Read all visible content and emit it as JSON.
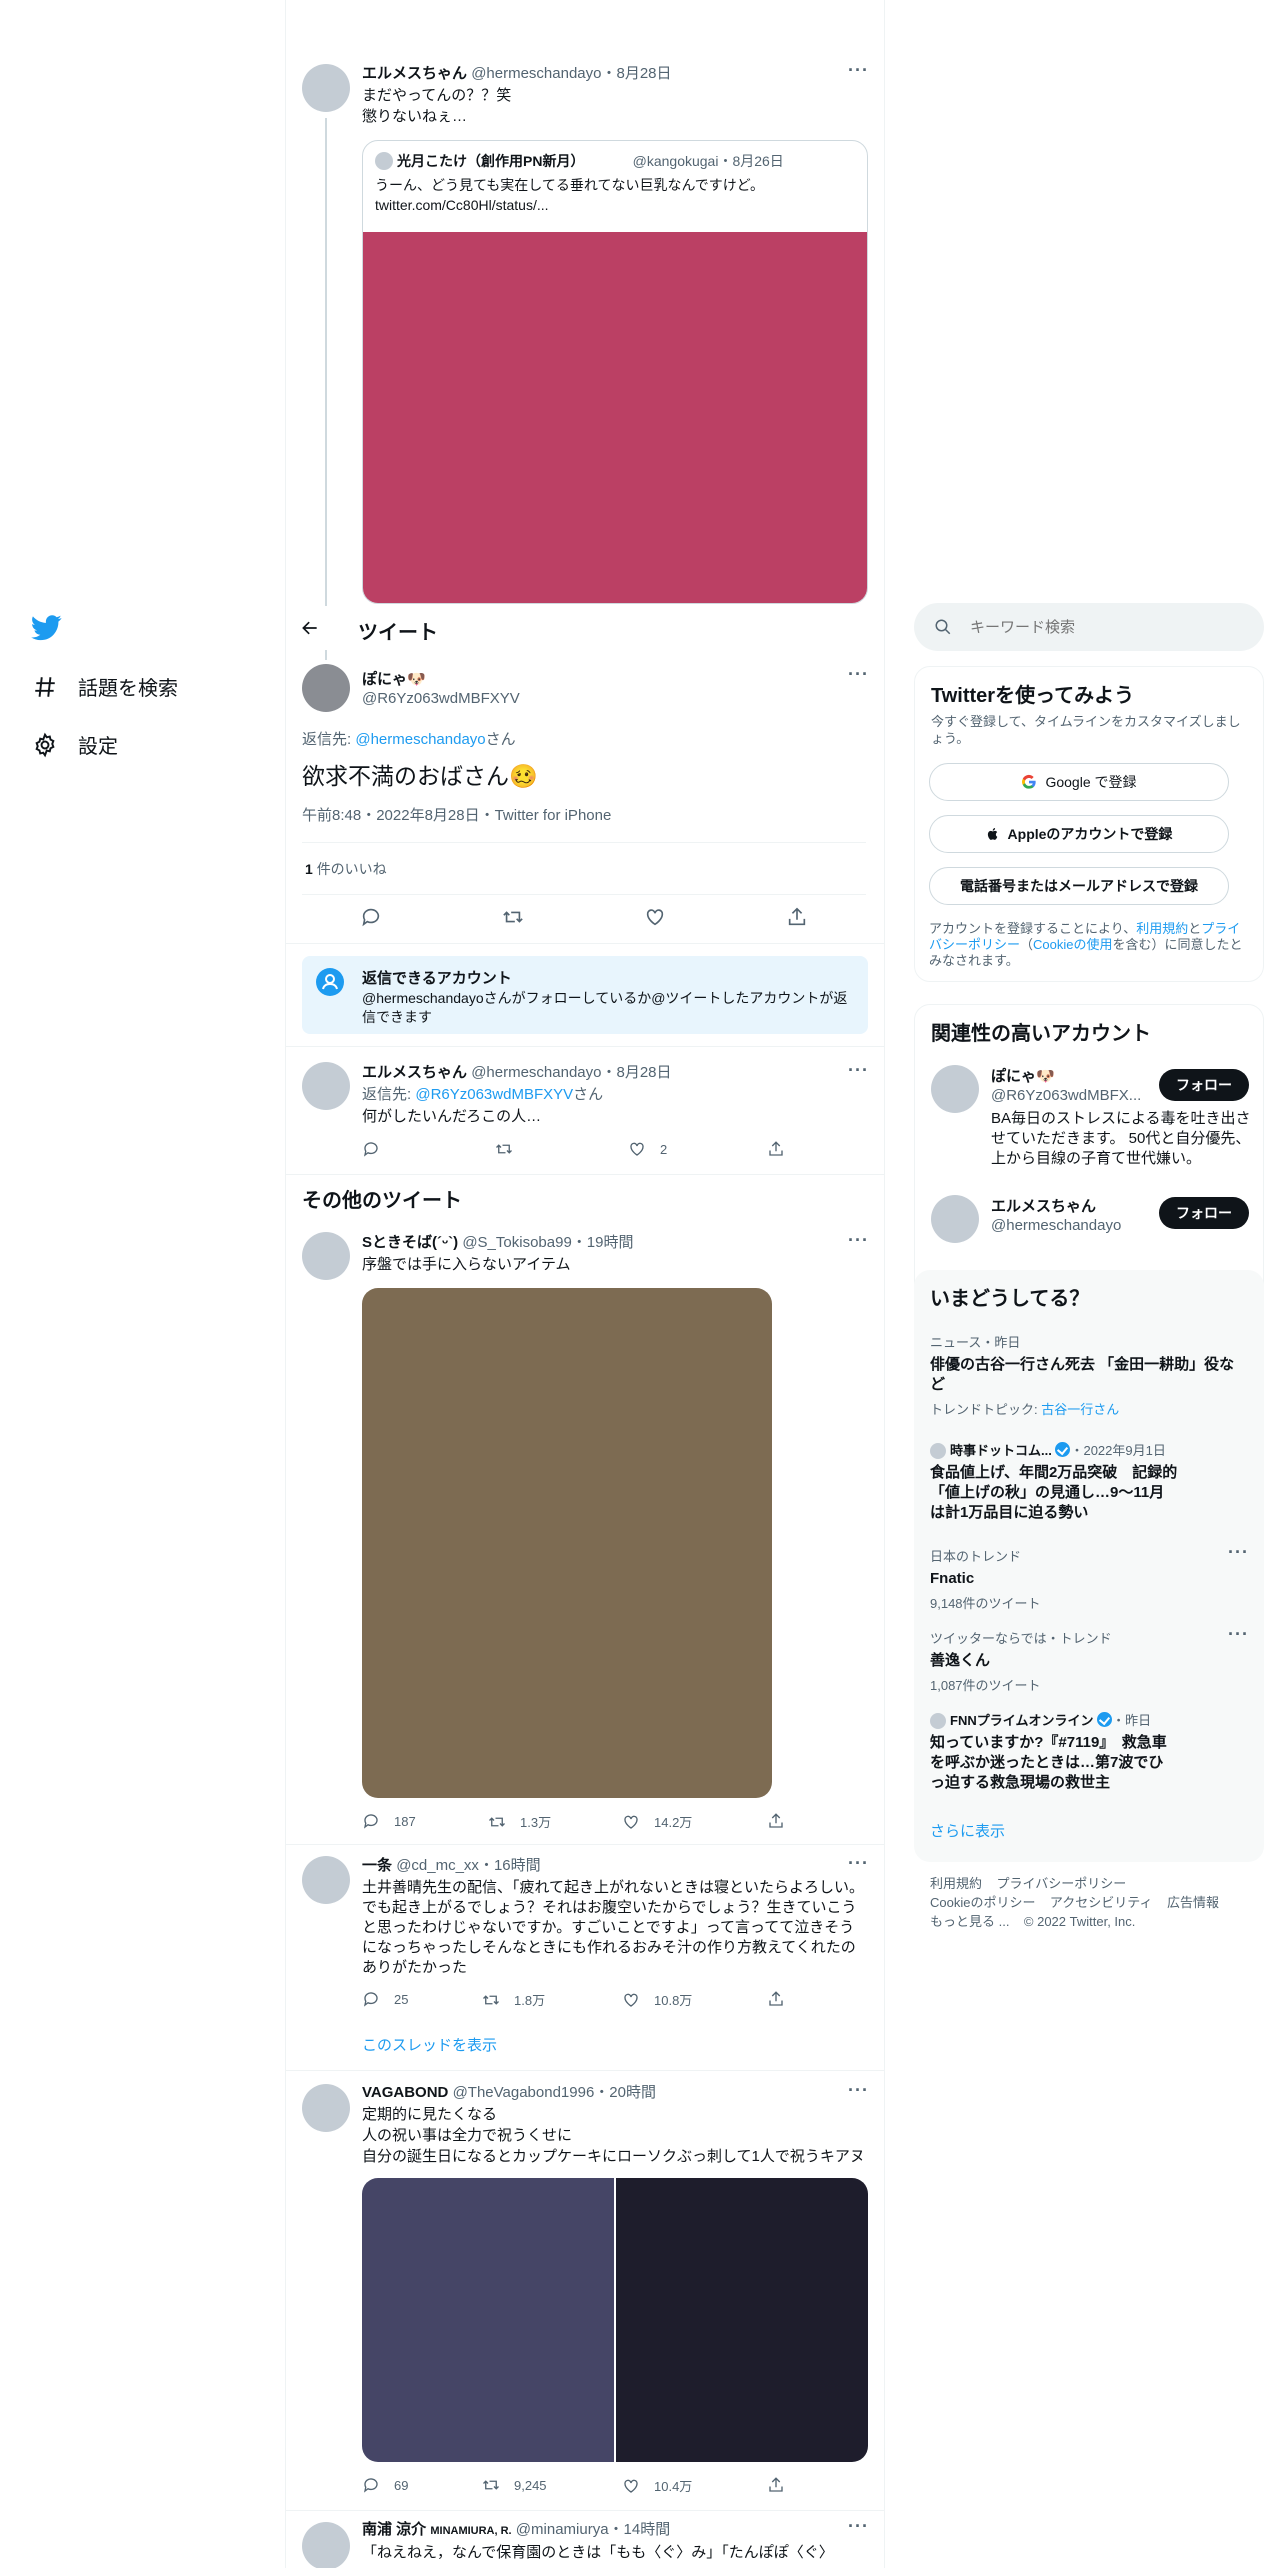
{
  "colors": {
    "accent": "#1d9bf0",
    "text": "#0f1419",
    "muted": "#536471",
    "border": "#eff3f4",
    "image_pink": "#bb4064",
    "image_brown": "#7d6b52",
    "image_navy": "#454566",
    "image_dark": "#1e1d2c"
  },
  "nav": {
    "logo": "twitter-bird-icon",
    "items": [
      {
        "icon": "hashtag-icon",
        "label": "話題を検索"
      },
      {
        "icon": "gear-icon",
        "label": "設定"
      }
    ]
  },
  "header": {
    "back_icon": "back-arrow-icon",
    "title": "ツイート"
  },
  "parent_tweet": {
    "name": "エルメスちゃん",
    "handle": "@hermeschandayo",
    "date": "・8月28日",
    "text1": "まだやってんの？？笑",
    "text2": "懲りないねぇ…",
    "quote": {
      "name": "光月こたけ（創作用PN新月）",
      "handle": "@kangokugai",
      "date": "・8月26日",
      "text": "うーん、どう見ても実在してる垂れてない巨乳なんですけど。",
      "link": "twitter.com/Cc80Hl/status/..."
    }
  },
  "main_tweet": {
    "name": "ぽにゃ🐶",
    "handle": "@R6Yz063wdMBFXYV",
    "reply_prefix": "返信先: ",
    "reply_to": "@hermeschandayo",
    "reply_suffix": "さん",
    "text": "欲求不満のおばさん🥴",
    "meta": "午前8:48・2022年8月28日・Twitter for iPhone",
    "likes_count": "1",
    "likes_label": "件のいいね"
  },
  "reply_notice": {
    "title": "返信できるアカウント",
    "text": "@hermeschandayoさんがフォローしているか@ツイートしたアカウントが返信できます"
  },
  "reply_tweet": {
    "name": "エルメスちゃん",
    "handle": "@hermeschandayo",
    "date": "・8月28日",
    "reply_prefix": "返信先: ",
    "reply_to": "@R6Yz063wdMBFXYV",
    "reply_suffix": "さん",
    "text": "何がしたいんだろこの人…",
    "likes": "2"
  },
  "other_tweets_title": "その他のツイート",
  "tweets": {
    "t1": {
      "name": "Sときそば(´ᵕ`)",
      "handle": "@S_Tokisoba99",
      "date": "・19時間",
      "text": "序盤では手に入らないアイテム",
      "replies": "187",
      "retweets": "1.3万",
      "likes": "14.2万"
    },
    "t2": {
      "name": "一条",
      "handle": "@cd_mc_xx",
      "date": "・16時間",
      "text": "土井善晴先生の配信、「疲れて起き上がれないときは寝といたらよろしい。でも起き上がるでしょう？それはお腹空いたからでしょう？生きていこうと思ったわけじゃないですか。すごいことですよ」って言ってて泣きそうになっちゃったしそんなときにも作れるおみそ汁の作り方教えてくれたのありがたかった",
      "replies": "25",
      "retweets": "1.8万",
      "likes": "10.8万",
      "thread": "このスレッドを表示"
    },
    "t3": {
      "name": "VAGABOND",
      "handle": "@TheVagabond1996",
      "date": "・20時間",
      "text1": "定期的に見たくなる",
      "text2": "人の祝い事は全力で祝うくせに",
      "text3": "自分の誕生日になるとカップケーキにローソクぶっ刺して1人で祝うキアヌ",
      "replies": "69",
      "retweets": "9,245",
      "likes": "10.4万"
    },
    "t4": {
      "name": "南浦 涼介",
      "name_suffix": "MINAMIURA, R.",
      "handle": "@minamiurya",
      "date": "・14時間",
      "text": "「ねえねえ，なんで保育園のときは「もも〈ぐ〉み」「たんぽぽ〈ぐ〉"
    }
  },
  "search": {
    "placeholder": "キーワード検索",
    "icon": "search-icon"
  },
  "signup": {
    "title": "Twitterを使ってみよう",
    "subtitle": "今すぐ登録して、タイムラインをカスタマイズしましょう。",
    "google": "Google で登録",
    "apple": "Appleのアカウントで登録",
    "phone": "電話番号またはメールアドレスで登録",
    "terms_prefix": "アカウントを登録することにより、",
    "terms_link1": "利用規約",
    "terms_mid1": "と",
    "terms_link2": "プライバシーポリシー",
    "terms_mid2": "（",
    "terms_link3": "Cookieの使用",
    "terms_suffix": "を含む）に同意したとみなされます。"
  },
  "related": {
    "title": "関連性の高いアカウント",
    "accounts": [
      {
        "name": "ぽにゃ🐶",
        "handle": "@R6Yz063wdMBFX...",
        "bio": "BA毎日のストレスによる毒を吐き出させていただきます。 50代と自分優先、上から目線の子育て世代嫌い。",
        "button": "フォロー"
      },
      {
        "name": "エルメスちゃん",
        "handle": "@hermeschandayo",
        "button": "フォロー"
      }
    ]
  },
  "trends": {
    "title": "いまどうしてる？",
    "items": [
      {
        "meta": "ニュース・昨日",
        "title": "俳優の古谷一行さん死去 「金田一耕助」役など",
        "topic_prefix": "トレンドトピック: ",
        "topic": "古谷一行さん"
      },
      {
        "source": "時事ドットコム...",
        "date": "・2022年9月1日",
        "title": "食品値上げ、年間2万品突破　記録的「値上げの秋」の見通し…9～11月は計1万品目に迫る勢い"
      },
      {
        "meta": "日本のトレンド",
        "title": "Fnatic",
        "count": "9,148件のツイート"
      },
      {
        "meta": "ツイッターならでは・トレンド",
        "title": "善逸くん",
        "count": "1,087件のツイート"
      },
      {
        "source": "FNNプライムオンライン",
        "date": "・昨日",
        "title": "知っていますか?『#7119』　救急車を呼ぶか迷ったときは…第7波でひっ迫する救急現場の救世主"
      }
    ],
    "more": "さらに表示"
  },
  "footer": {
    "links": [
      "利用規約",
      "プライバシーポリシー",
      "Cookieのポリシー",
      "アクセシビリティ",
      "広告情報",
      "もっと見る ..."
    ],
    "copyright": "© 2022 Twitter, Inc."
  }
}
